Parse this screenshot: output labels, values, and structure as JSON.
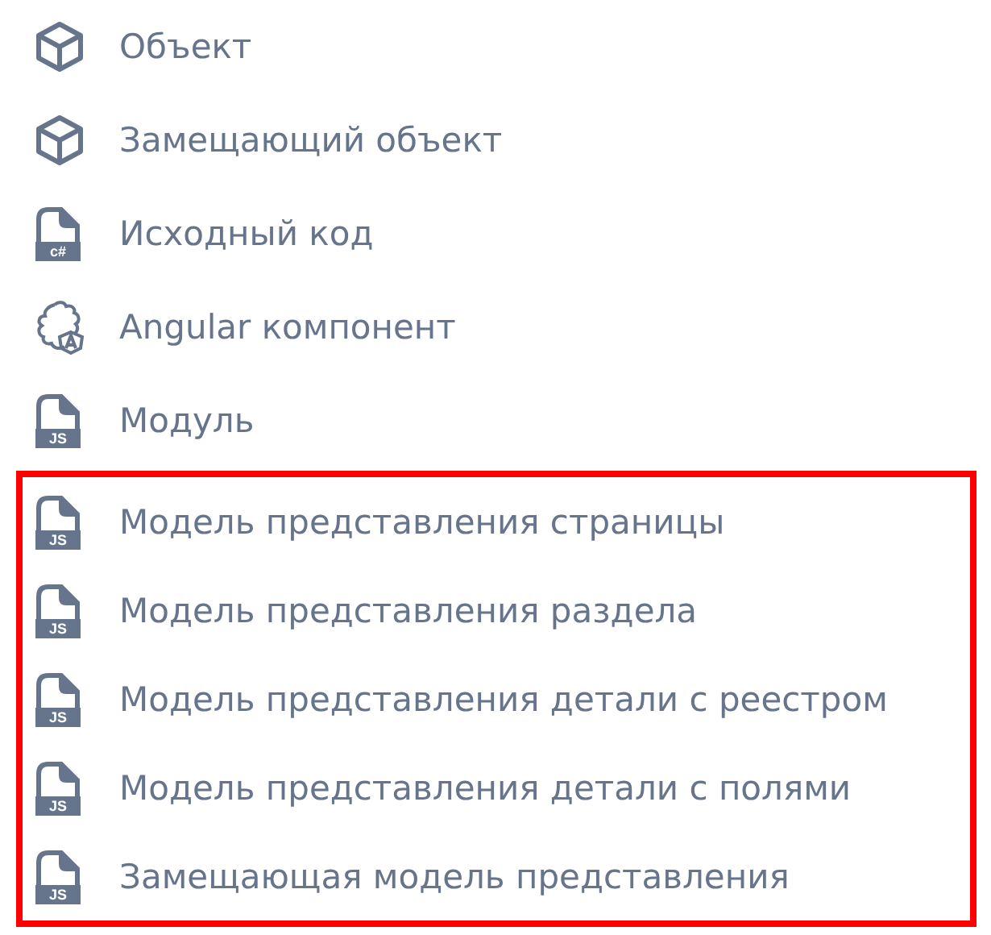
{
  "groups": [
    {
      "highlighted": false,
      "items": [
        {
          "kind": "cube",
          "label": "Объект"
        },
        {
          "kind": "cube",
          "label": "Замещающий объект"
        },
        {
          "kind": "file",
          "badge": "c#",
          "label": "Исходный код"
        },
        {
          "kind": "angular",
          "label": "Angular компонент"
        },
        {
          "kind": "file",
          "badge": "JS",
          "label": "Модуль"
        }
      ]
    },
    {
      "highlighted": true,
      "items": [
        {
          "kind": "file",
          "badge": "JS",
          "label": "Модель представления страницы"
        },
        {
          "kind": "file",
          "badge": "JS",
          "label": "Модель представления раздела"
        },
        {
          "kind": "file",
          "badge": "JS",
          "label": "Модель представления детали с реестром"
        },
        {
          "kind": "file",
          "badge": "JS",
          "label": "Модель представления детали с полями"
        },
        {
          "kind": "file",
          "badge": "JS",
          "label": "Замещающая модель представления"
        }
      ]
    }
  ]
}
